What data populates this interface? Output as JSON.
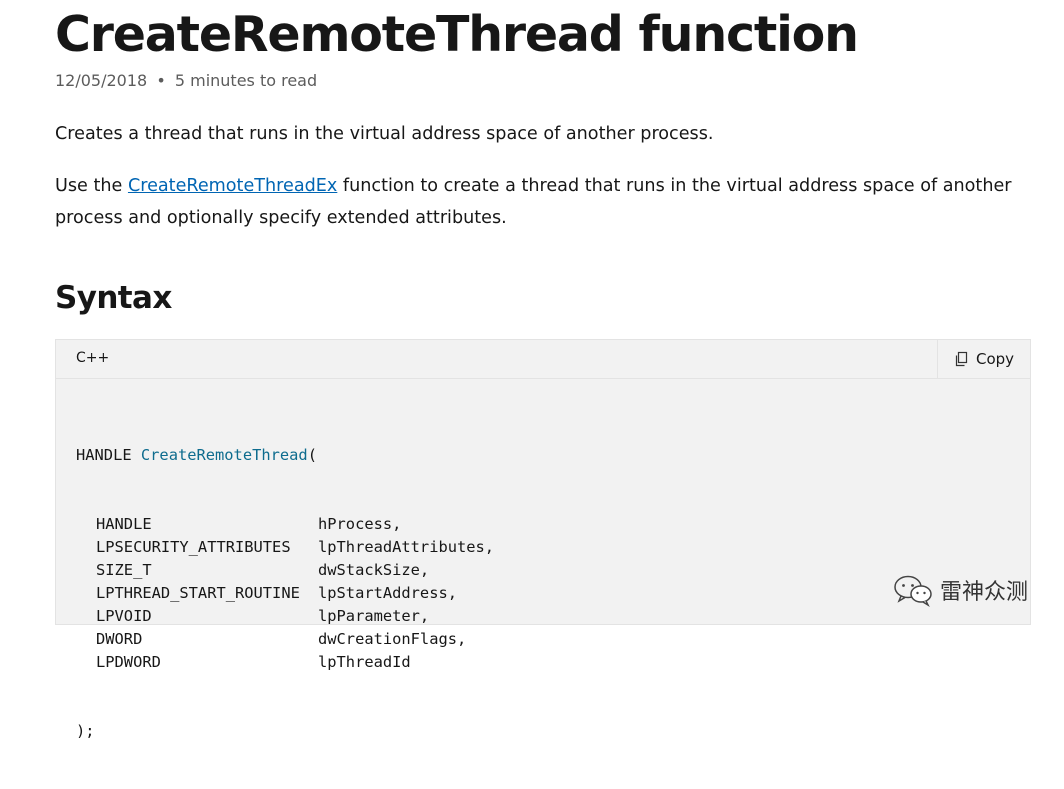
{
  "article": {
    "title": "CreateRemoteThread function",
    "date": "12/05/2018",
    "separator": "•",
    "read_time": "5 minutes to read",
    "intro": "Creates a thread that runs in the virtual address space of another process.",
    "para2": {
      "prefix": "Use the ",
      "link_text": "CreateRemoteThreadEx",
      "suffix": " function to create a thread that runs in the virtual address space of another process and optionally specify extended attributes."
    },
    "syntax_heading": "Syntax"
  },
  "code": {
    "language": "C++",
    "copy_label": "Copy",
    "copy_icon": "copy-icon",
    "return_type": "HANDLE",
    "function_name": "CreateRemoteThread",
    "open_paren": "(",
    "closing": ");",
    "params": [
      {
        "type": "HANDLE",
        "name": "hProcess,"
      },
      {
        "type": "LPSECURITY_ATTRIBUTES",
        "name": "lpThreadAttributes,"
      },
      {
        "type": "SIZE_T",
        "name": "dwStackSize,"
      },
      {
        "type": "LPTHREAD_START_ROUTINE",
        "name": "lpStartAddress,"
      },
      {
        "type": "LPVOID",
        "name": "lpParameter,"
      },
      {
        "type": "DWORD",
        "name": "dwCreationFlags,"
      },
      {
        "type": "LPDWORD",
        "name": "lpThreadId"
      }
    ]
  },
  "watermark": {
    "text": "雷神众测",
    "icon": "wechat-icon"
  },
  "colors": {
    "link": "#0065b3",
    "code_function": "#0e6c8e",
    "code_background": "#f2f2f2"
  }
}
